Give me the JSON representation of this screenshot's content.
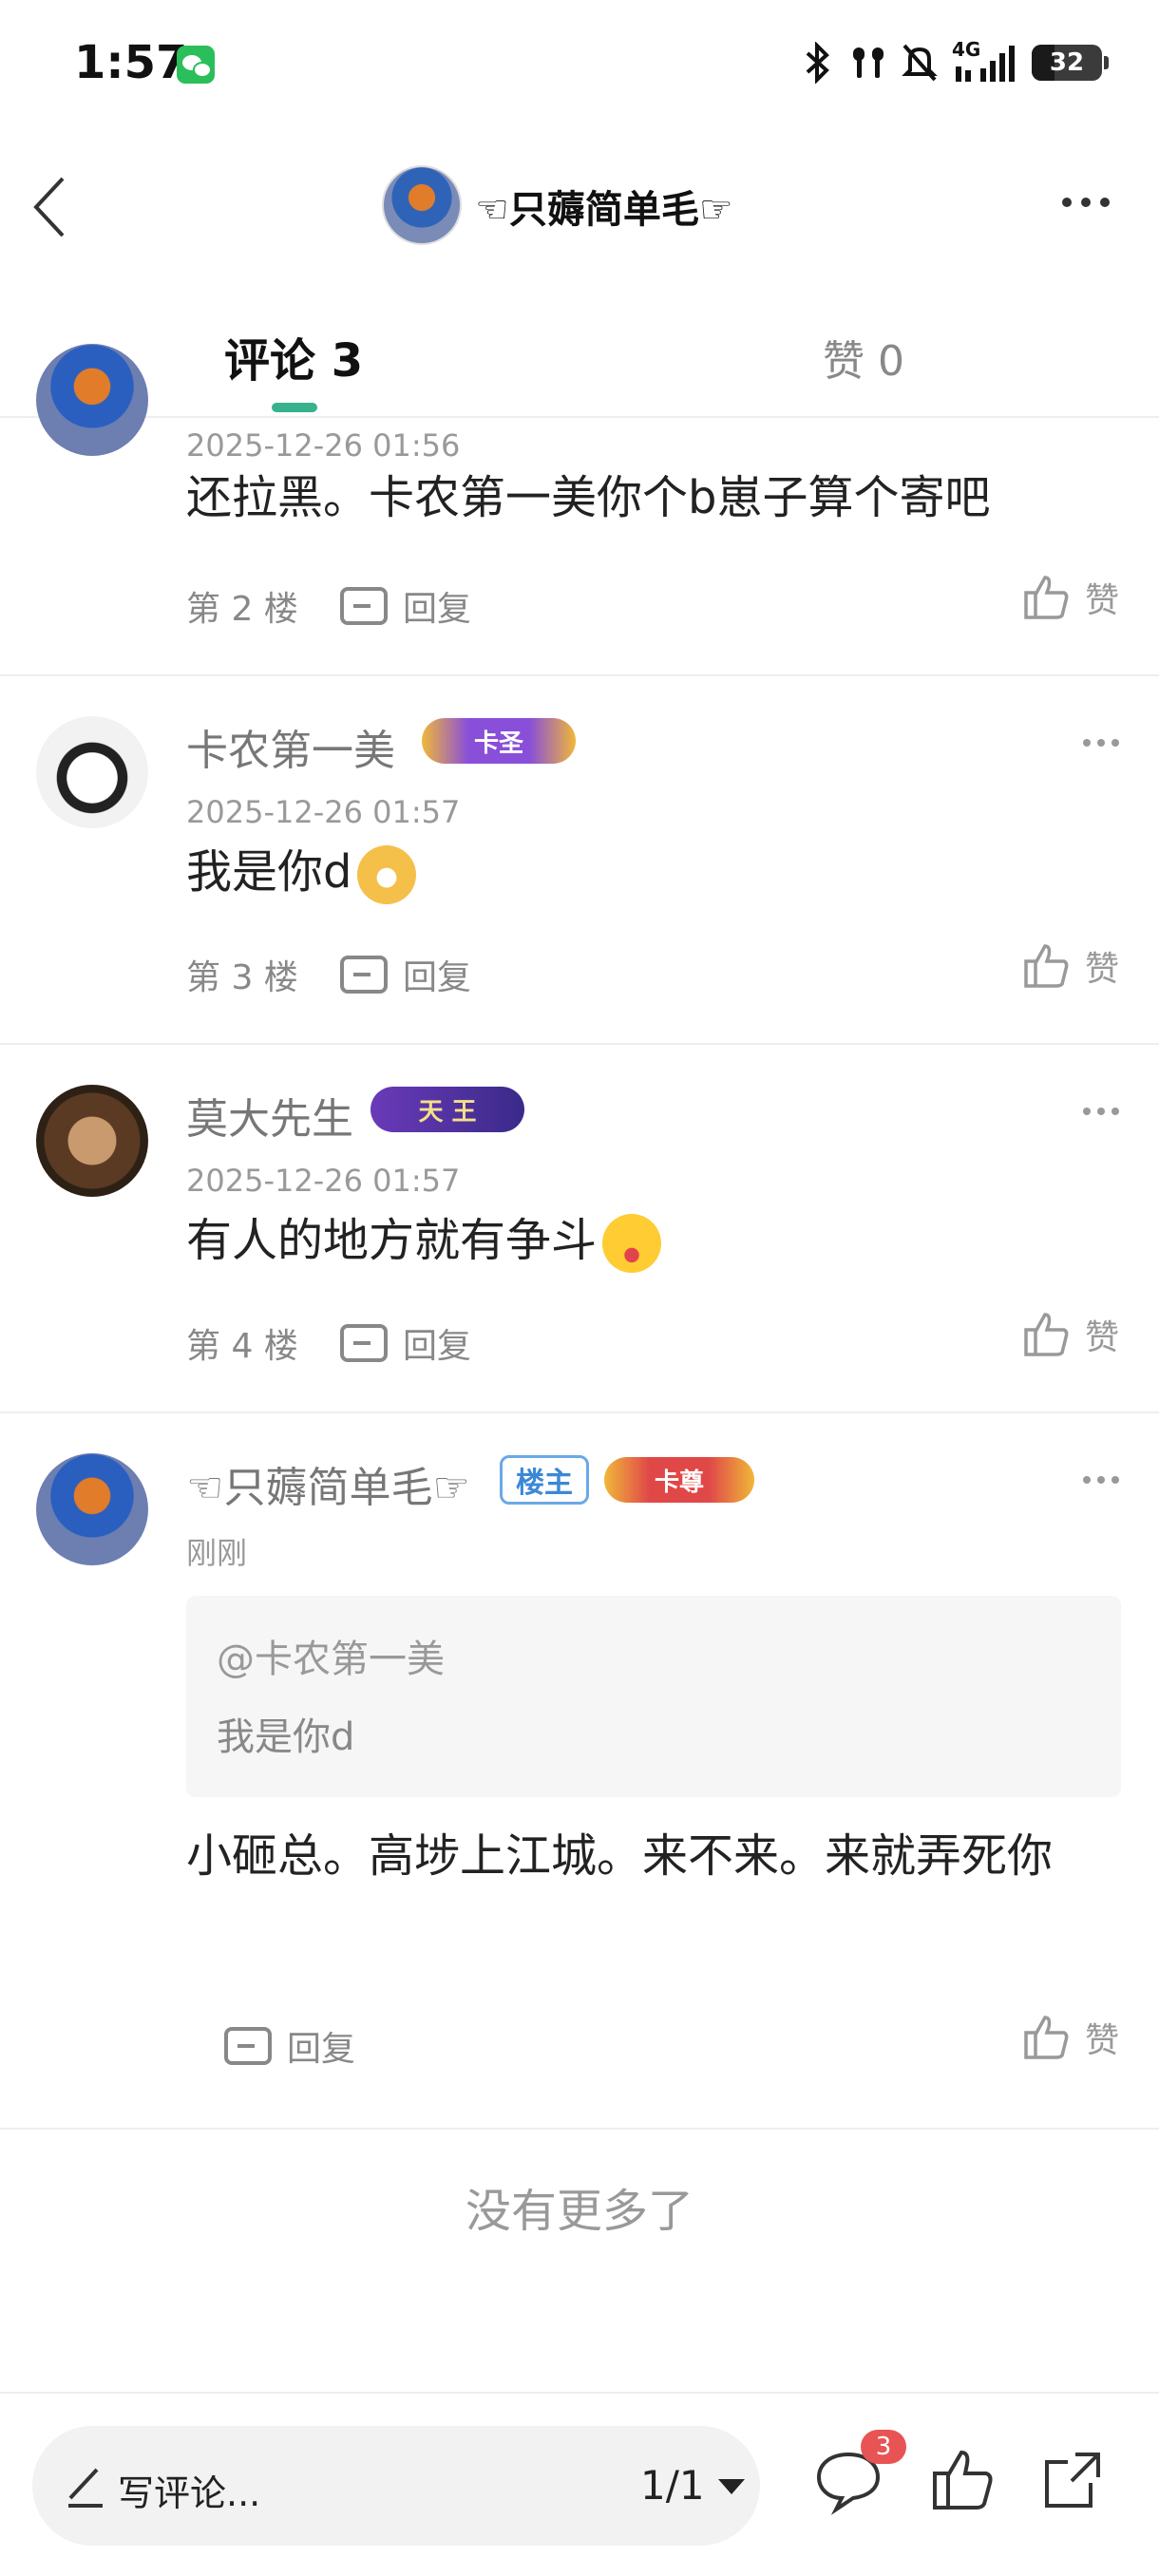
{
  "status_bar": {
    "time": "1:57",
    "network": "4G",
    "battery": "32"
  },
  "header": {
    "title": "☜只薅简单毛☞"
  },
  "tabs": {
    "comments": "评论 3",
    "likes": "赞 0"
  },
  "comments": [
    {
      "time": "2025-12-26 01:56",
      "text": "还拉黑。卡农第一美你个b崽子算个寄吧",
      "floor": "第 2 楼",
      "reply": "回复",
      "like": "赞"
    },
    {
      "name": "卡农第一美",
      "badge": "卡圣",
      "time": "2025-12-26 01:57",
      "text": "我是你d",
      "emoji": "dog-emoji",
      "floor": "第 3 楼",
      "reply": "回复",
      "like": "赞"
    },
    {
      "name": "莫大先生",
      "badge": "天 王",
      "time": "2025-12-26 01:57",
      "text": "有人的地方就有争斗",
      "emoji": "starstruck-emoji",
      "floor": "第 4 楼",
      "reply": "回复",
      "like": "赞"
    },
    {
      "name": "☜只薅简单毛☞",
      "owner_badge": "楼主",
      "badge": "卡尊",
      "time": "刚刚",
      "quote": {
        "at": "@卡农第一美",
        "text": "我是你d"
      },
      "text": "小砸总。高埗上江城。来不来。来就弄死你",
      "reply": "回复",
      "like": "赞"
    }
  ],
  "no_more": "没有更多了",
  "bottom_bar": {
    "placeholder": "写评论...",
    "page": "1/1",
    "comment_count": "3"
  },
  "icons": [
    "bluetooth-icon",
    "earbuds-icon",
    "mute-icon",
    "signal-icon",
    "back-icon",
    "more-icon",
    "reply-icon",
    "like-icon",
    "pencil-icon",
    "comment-icon",
    "thumbs-up-icon",
    "share-icon"
  ],
  "colors": {
    "accent": "#37b28d",
    "badge_red": "#e85454",
    "owner_blue": "#3c88d6"
  }
}
